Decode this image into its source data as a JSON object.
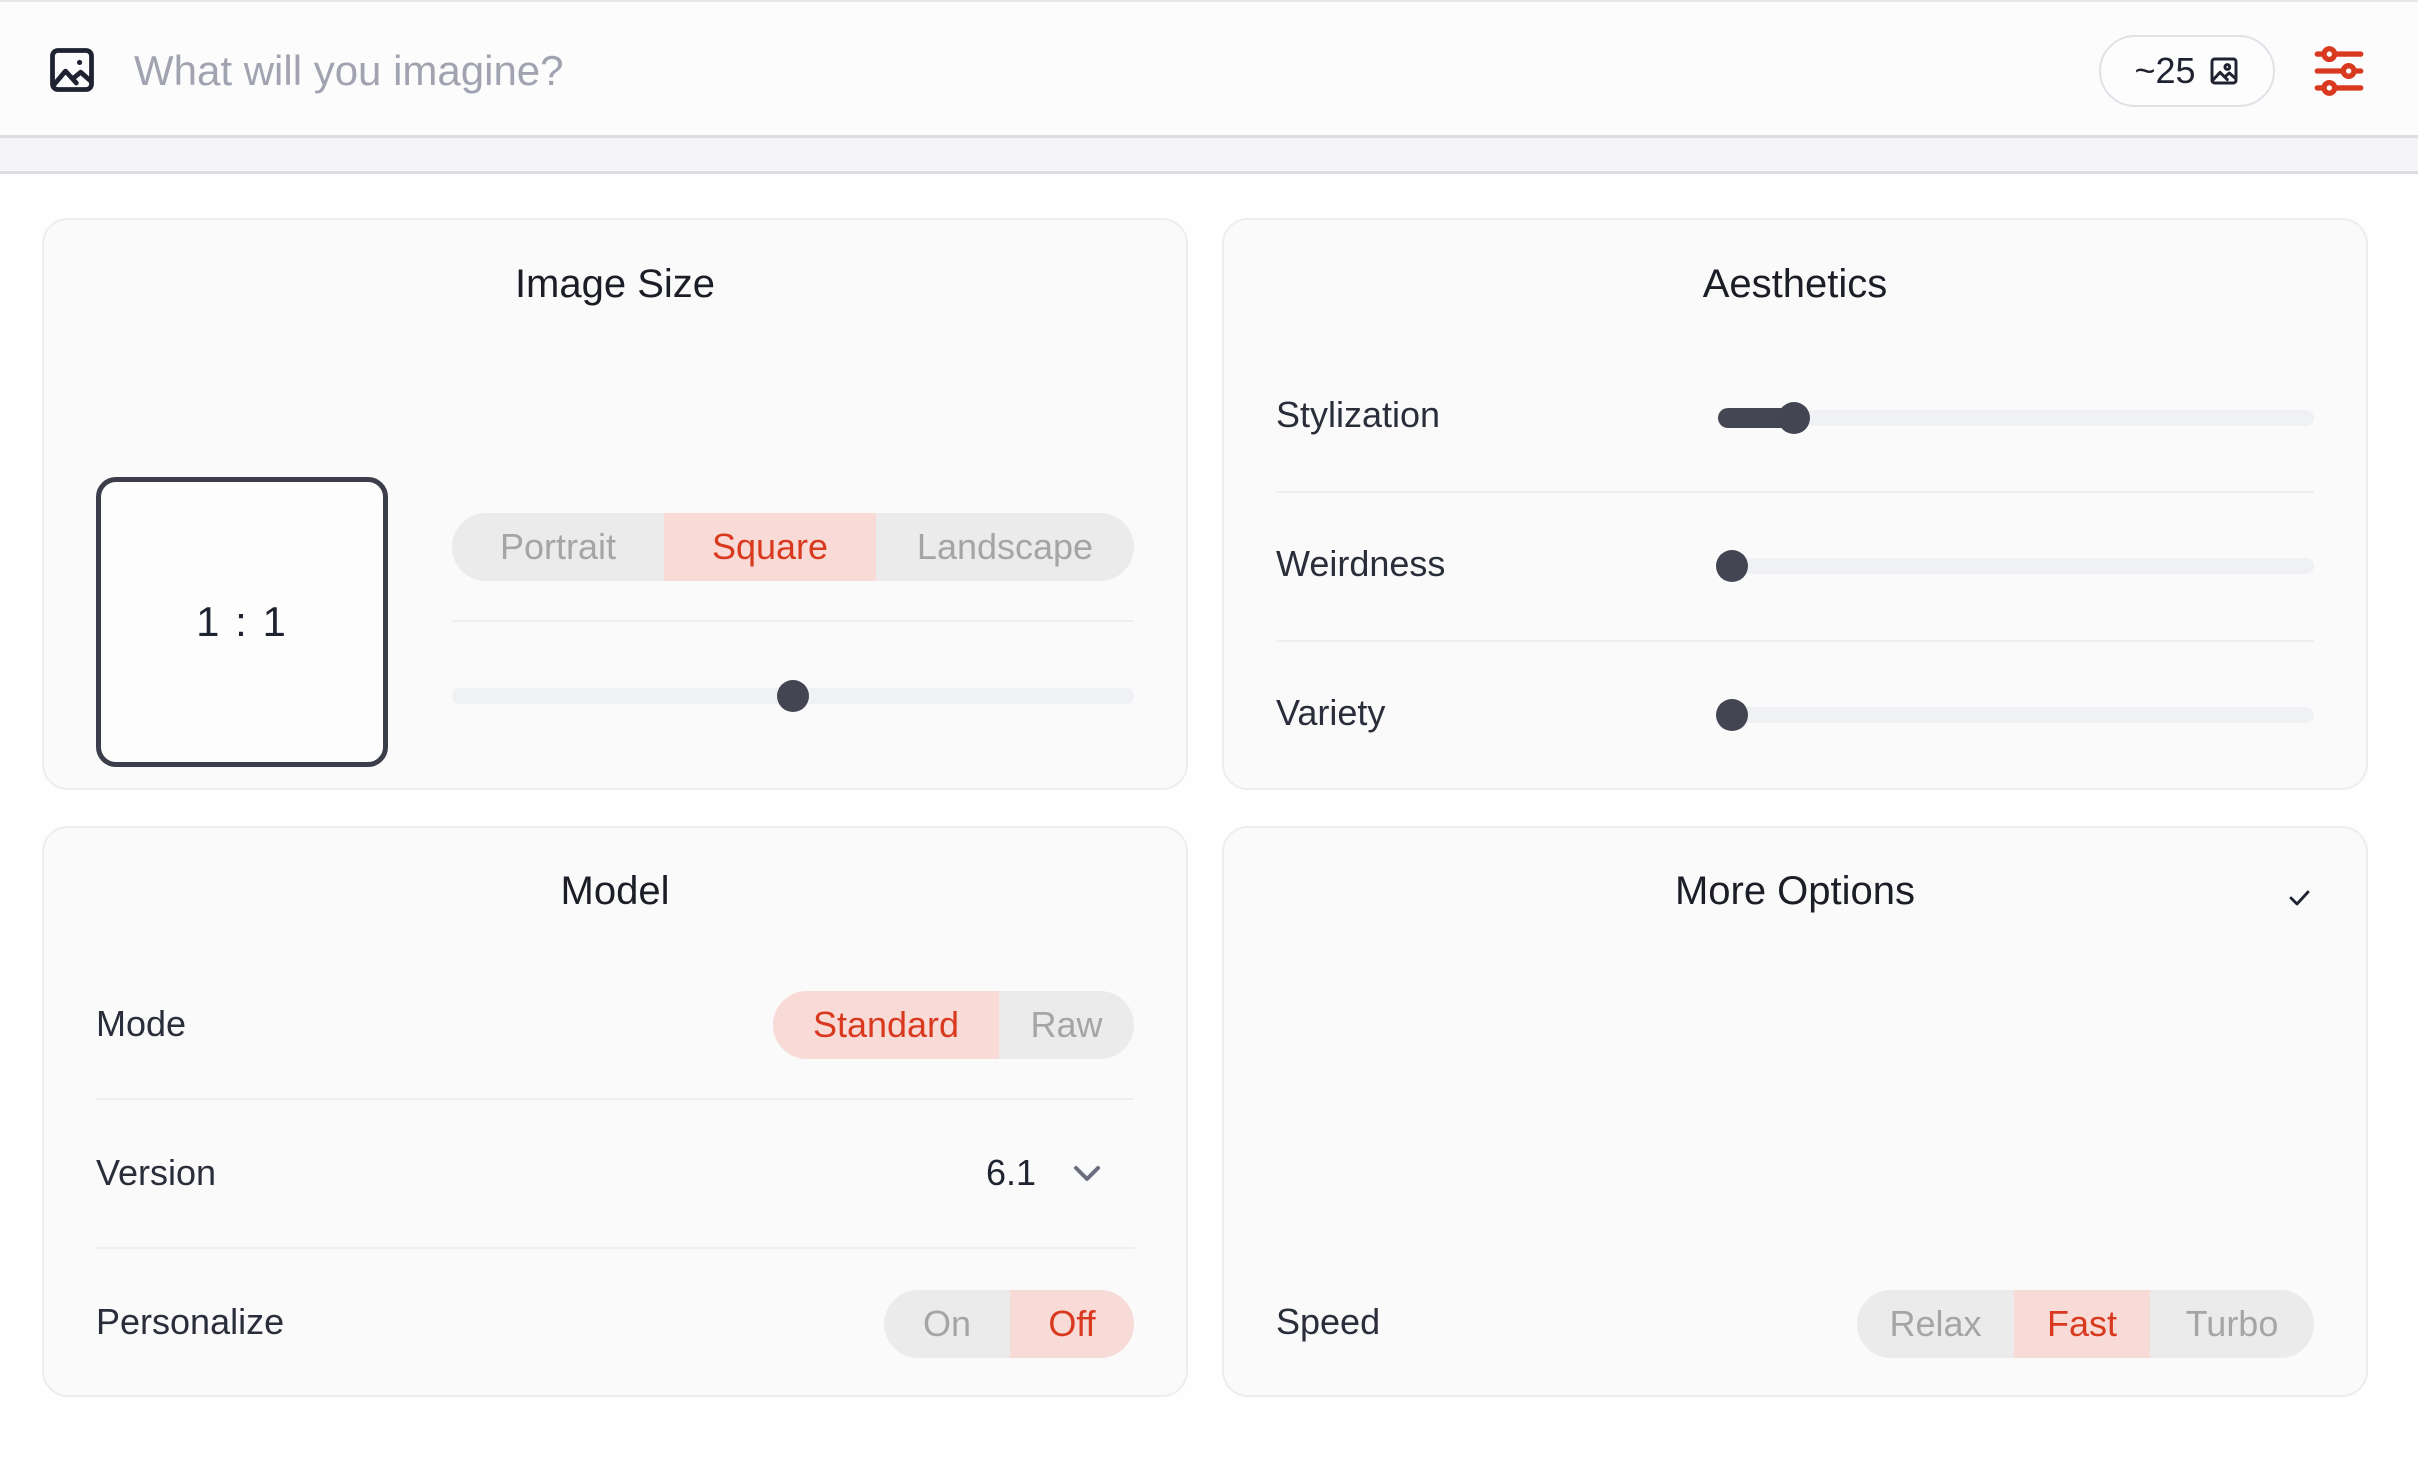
{
  "topbar": {
    "prompt_placeholder": "What will you imagine?",
    "prompt_value": "",
    "credits_label": "~25",
    "icons": {
      "prompt": "image-icon",
      "credits": "image-icon",
      "settings": "sliders-icon"
    }
  },
  "colors": {
    "accent": "#d93a1f",
    "accent_bg": "#f8dad6",
    "inactive_bg": "#ebebeb",
    "slider_thumb": "#434552"
  },
  "image_size": {
    "title": "Image Size",
    "ratio": "1 : 1",
    "orientation_options": [
      "Portrait",
      "Square",
      "Landscape"
    ],
    "orientation_selected": "Square",
    "ratio_slider_value": 0.5
  },
  "aesthetics": {
    "title": "Aesthetics",
    "sliders": [
      {
        "label": "Stylization",
        "value": 0.11
      },
      {
        "label": "Weirdness",
        "value": 0.0
      },
      {
        "label": "Variety",
        "value": 0.0
      }
    ]
  },
  "model": {
    "title": "Model",
    "mode_label": "Mode",
    "mode_options": [
      "Standard",
      "Raw"
    ],
    "mode_selected": "Standard",
    "version_label": "Version",
    "version_value": "6.1",
    "personalize_label": "Personalize",
    "personalize_options": [
      "On",
      "Off"
    ],
    "personalize_selected": "Off"
  },
  "more_options": {
    "title": "More Options",
    "expanded_icon": "check-icon",
    "speed_label": "Speed",
    "speed_options": [
      "Relax",
      "Fast",
      "Turbo"
    ],
    "speed_selected": "Fast"
  }
}
